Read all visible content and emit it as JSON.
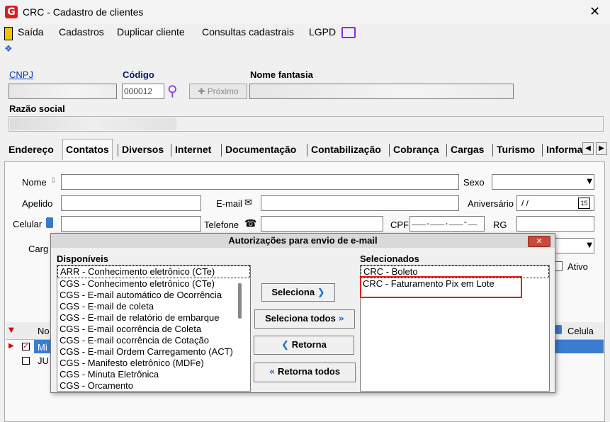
{
  "window": {
    "title": "CRC - Cadastro de clientes",
    "close": "✕"
  },
  "menu": {
    "exit": "Saída",
    "items": [
      "Cadastros",
      "Duplicar cliente",
      "Consultas cadastrais",
      "LGPD"
    ]
  },
  "header": {
    "cnpj_label": "CNPJ",
    "codigo_label": "Código",
    "codigo_value": "000012",
    "proximo_label": "Próximo",
    "nome_fantasia_label": "Nome fantasia",
    "razao_social_label": "Razão social"
  },
  "tabs": [
    "Endereço",
    "Contatos",
    "Diversos",
    "Internet",
    "Documentação",
    "Contabilização",
    "Cobrança",
    "Cargas",
    "Turismo",
    "Informa"
  ],
  "contacts_form": {
    "nome_label": "Nome",
    "sexo_label": "Sexo",
    "apelido_label": "Apelido",
    "email_label": "E-mail",
    "aniversario_label": "Aniversário",
    "aniversario_value": "/ /",
    "celular_label": "Celular",
    "telefone_label": "Telefone",
    "cpf_label": "CPF",
    "cpf_mask": "___.___.___-__",
    "rg_label": "RG",
    "cargo_label": "Carg",
    "ativo_label": "Ativo",
    "calendar_day": "15"
  },
  "grid": {
    "col_name": "No",
    "col_celular": "Celula",
    "rows": [
      "Mi",
      "JU"
    ]
  },
  "modal": {
    "title": "Autorizações para envio de e-mail",
    "close": "✕",
    "available_label": "Disponíveis",
    "selected_label": "Selecionados",
    "available": [
      "ARR - Conhecimento eletrônico (CTe)",
      "CGS - Conhecimento eletrônico (CTe)",
      "CGS - E-mail automático de Ocorrência",
      "CGS - E-mail de coleta",
      "CGS - E-mail de relatório de embarque",
      "CGS - E-mail ocorrência de Coleta",
      "CGS - E-mail ocorrência de Cotação",
      "CGS - E-mail Ordem Carregamento (ACT)",
      "CGS - Manifesto eletrônico (MDFe)",
      "CGS - Minuta Eletrônica",
      "CGS - Orcamento"
    ],
    "selected": [
      "CRC - Boleto",
      "CRC - Faturamento Pix em Lote"
    ],
    "btn_seleciona": "Seleciona",
    "btn_seleciona_todos": "Seleciona todos",
    "btn_retorna": "Retorna",
    "btn_retorna_todos": "Retorna todos"
  }
}
